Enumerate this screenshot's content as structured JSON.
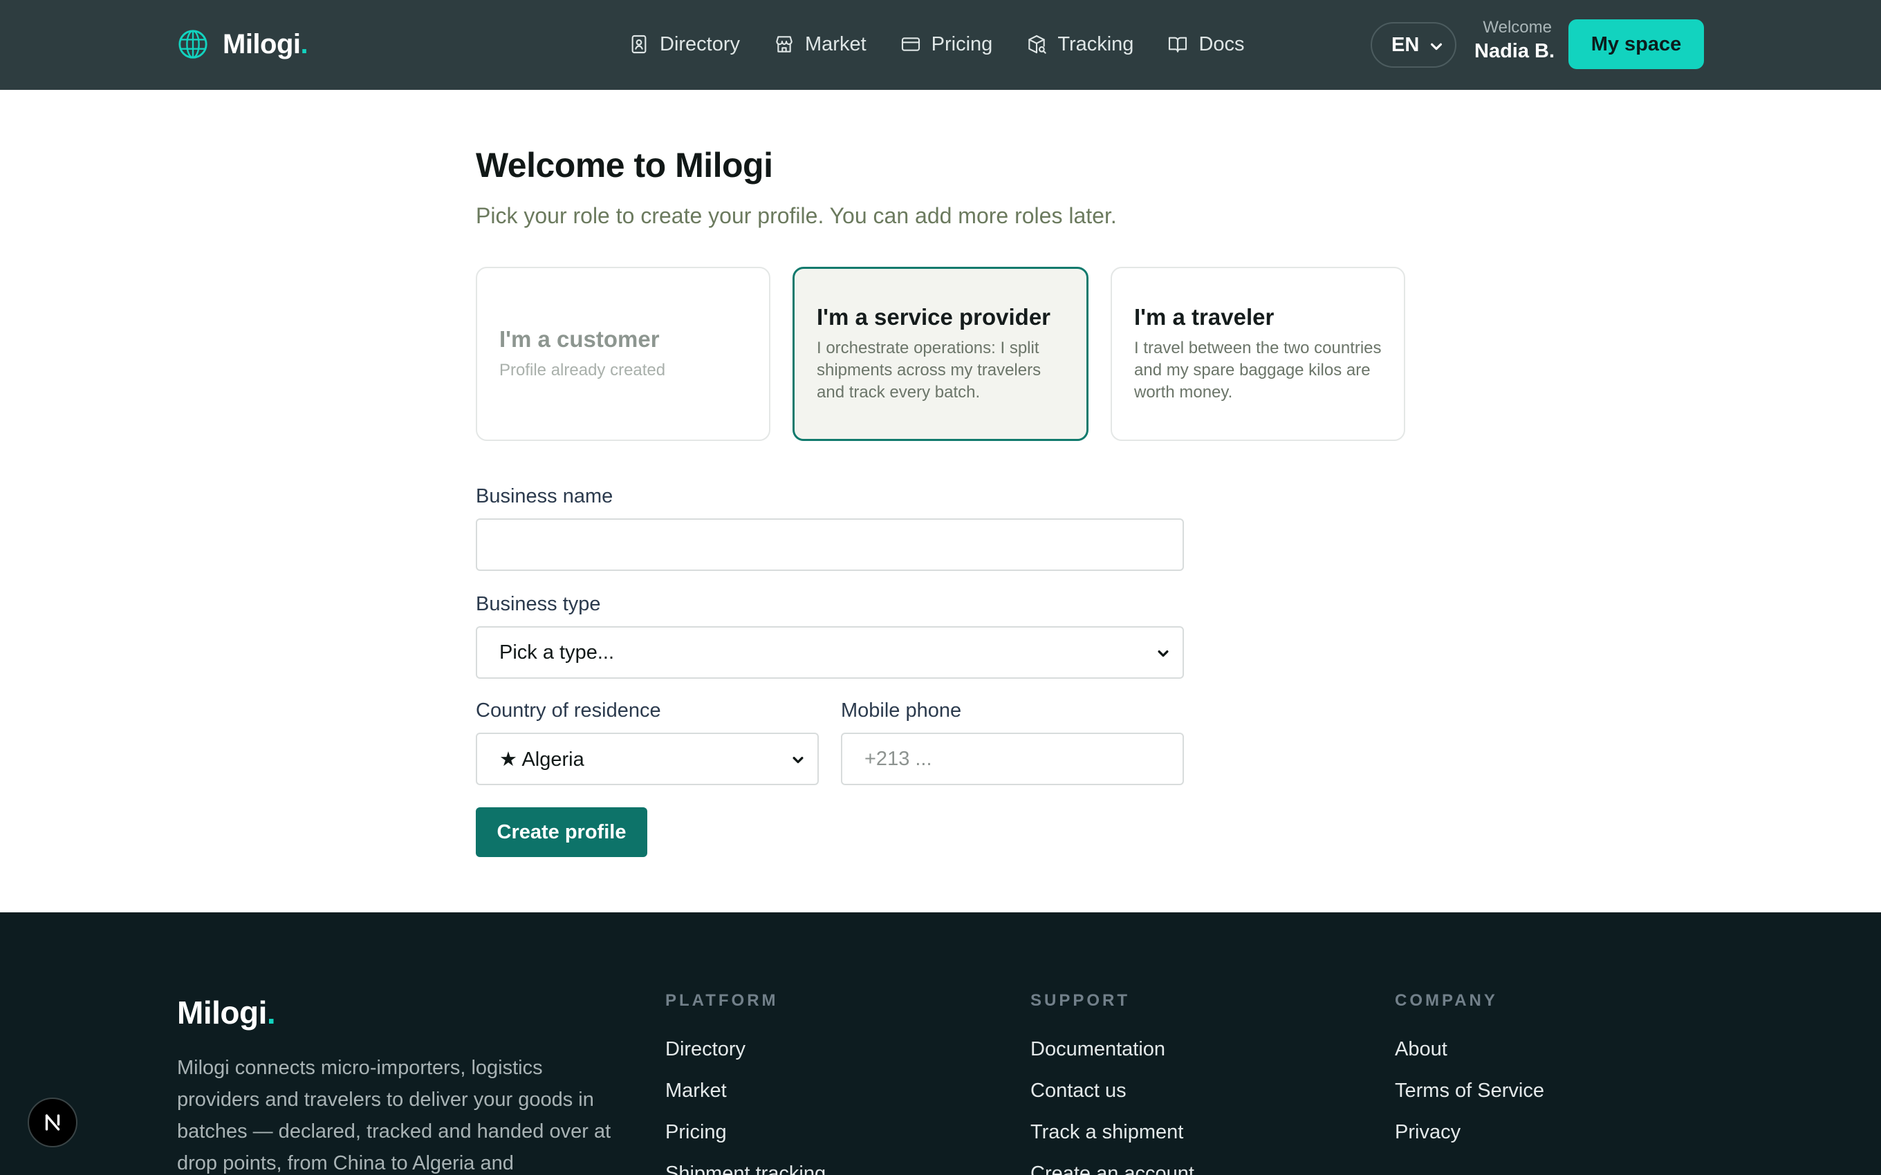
{
  "header": {
    "brand": "Milogi",
    "brand_dot": ".",
    "nav": [
      {
        "label": "Directory",
        "icon": "contact-book-icon"
      },
      {
        "label": "Market",
        "icon": "store-icon"
      },
      {
        "label": "Pricing",
        "icon": "credit-card-icon"
      },
      {
        "label": "Tracking",
        "icon": "package-search-icon"
      },
      {
        "label": "Docs",
        "icon": "open-book-icon"
      }
    ],
    "language": "EN",
    "welcome_label": "Welcome",
    "user_name": "Nadia B.",
    "my_space_label": "My space"
  },
  "main": {
    "title": "Welcome to Milogi",
    "subtitle": "Pick your role to create your profile. You can add more roles later.",
    "roles": [
      {
        "title": "I'm a customer",
        "desc": "Profile already created",
        "state": "disabled"
      },
      {
        "title": "I'm a service provider",
        "desc": "I orchestrate operations: I split shipments across my travelers and track every batch.",
        "state": "selected"
      },
      {
        "title": "I'm a traveler",
        "desc": "I travel between the two countries and my spare baggage kilos are worth money.",
        "state": "default"
      }
    ],
    "form": {
      "business_name_label": "Business name",
      "business_name_value": "",
      "business_type_label": "Business type",
      "business_type_value": "Pick a type...",
      "country_label": "Country of residence",
      "country_value": "★ Algeria",
      "phone_label": "Mobile phone",
      "phone_placeholder": "+213 ...",
      "submit_label": "Create profile"
    }
  },
  "footer": {
    "brand": "Milogi",
    "brand_dot": ".",
    "about": "Milogi connects micro-importers, logistics providers and travelers to deliver your goods in batches — declared, tracked and handed over at drop points, from China to Algeria and",
    "columns": [
      {
        "heading": "PLATFORM",
        "links": [
          "Directory",
          "Market",
          "Pricing",
          "Shipment tracking"
        ]
      },
      {
        "heading": "SUPPORT",
        "links": [
          "Documentation",
          "Contact us",
          "Track a shipment",
          "Create an account"
        ]
      },
      {
        "heading": "COMPANY",
        "links": [
          "About",
          "Terms of Service",
          "Privacy"
        ]
      }
    ]
  },
  "badge": {
    "letter": "N"
  },
  "colors": {
    "header_bg": "#2e3d40",
    "accent": "#12d3bf",
    "primary_button": "#0d7369",
    "selected_card_border": "#117a6d",
    "footer_bg": "#0d1c20"
  }
}
